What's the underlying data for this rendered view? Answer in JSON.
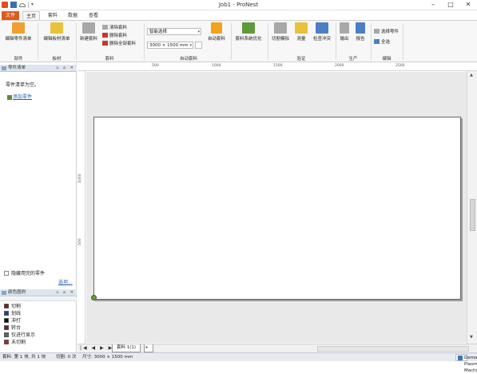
{
  "window": {
    "title": "Job1 - ProNest",
    "buttons": [
      "–",
      "□",
      "✕"
    ]
  },
  "tabs": [
    {
      "label": "文件"
    },
    {
      "label": "主页"
    },
    {
      "label": "套料"
    },
    {
      "label": "数据"
    },
    {
      "label": "查看"
    }
  ],
  "ribbon": {
    "edit_part_list": "编辑零件清单",
    "edit_plate_list": "编辑板材清单",
    "new_nest": "新建套料",
    "clear_nest": "清除套料",
    "delete_nest": "删除套料",
    "delete_all_nests": "删除全部套料",
    "smart_select": "智能选择",
    "plate_size": "3000 × 1500 mm",
    "auto_nest": "自动套料",
    "nest_optimize": "套料系统优化",
    "cut_simulate": "切割模拟",
    "measure": "测量",
    "check_collision": "检查冲突",
    "output": "输出",
    "report": "报告",
    "select_parts": "选择零件",
    "select_all": "全选",
    "groups": {
      "parts": "部件",
      "plate": "板材",
      "nest": "套料",
      "auto_nest": "自动套料",
      "verify": "验证",
      "produce": "生产",
      "edit": "编辑"
    }
  },
  "part_list_panel": {
    "title": "零件清单",
    "controls": "▫ ⌂ ✕",
    "empty_message": "零件清单为空。",
    "add_part": "添加零件",
    "hide_used": "隐藏用完的零件",
    "options": "选项..."
  },
  "color_legend_panel": {
    "title": "颜色图例",
    "controls": "▫ ⌂ ✕",
    "items": [
      {
        "label": "切割",
        "color": "#8b1a1a"
      },
      {
        "label": "划线",
        "color": "#1a3ea8"
      },
      {
        "label": "冲打",
        "color": "#111111"
      },
      {
        "label": "转台",
        "color": "#7a1f1f"
      },
      {
        "label": "仅进行显示",
        "color": "#666666"
      },
      {
        "label": "未切割",
        "color": "#c02020"
      }
    ]
  },
  "ruler": {
    "h_ticks": [
      "500",
      "1000",
      "1500",
      "2000",
      "2500"
    ],
    "v_ticks": [
      "1000",
      "500"
    ]
  },
  "sheet_tabs": {
    "nav": "|◀ ◀ ▶ ▶|",
    "active": "套料 1(1)",
    "add": "+"
  },
  "status": {
    "left": "套料: 第 1 块, 共 1 块",
    "cut_time": "切割: 0 次",
    "size": "尺寸: 3000 × 1500 mm",
    "machine": "Demo Plasma Machine"
  }
}
